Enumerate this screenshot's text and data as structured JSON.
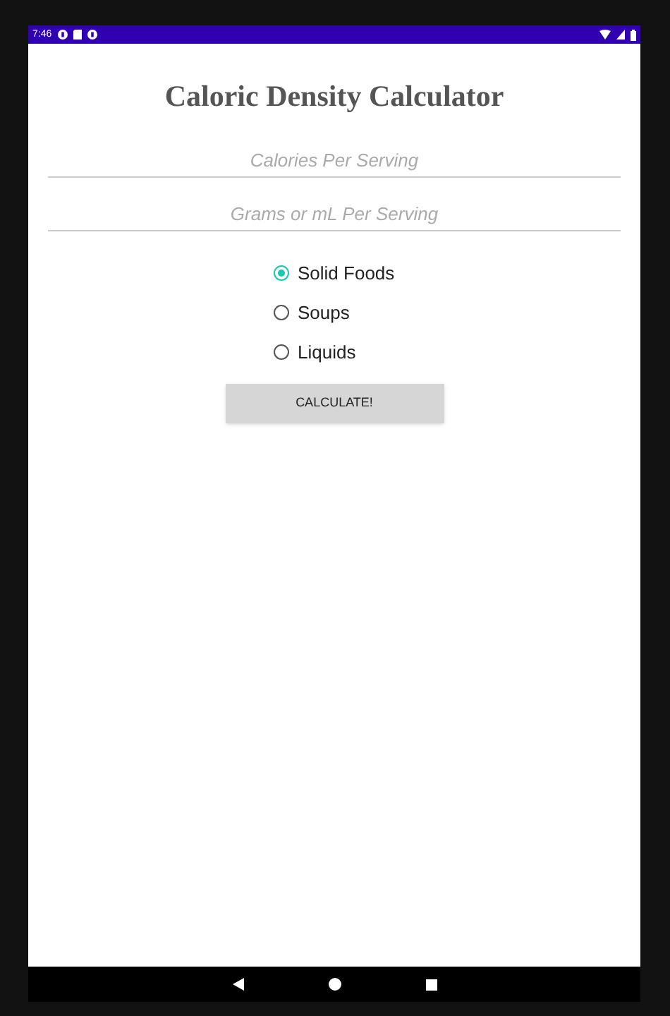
{
  "status_bar": {
    "time": "7:46"
  },
  "title": "Caloric Density Calculator",
  "fields": [
    {
      "placeholder": "Calories Per Serving"
    },
    {
      "placeholder": "Grams or mL Per Serving"
    }
  ],
  "food_types": [
    {
      "label": "Solid Foods",
      "selected": true
    },
    {
      "label": "Soups",
      "selected": false
    },
    {
      "label": "Liquids",
      "selected": false
    }
  ],
  "button": "CALCULATE!"
}
